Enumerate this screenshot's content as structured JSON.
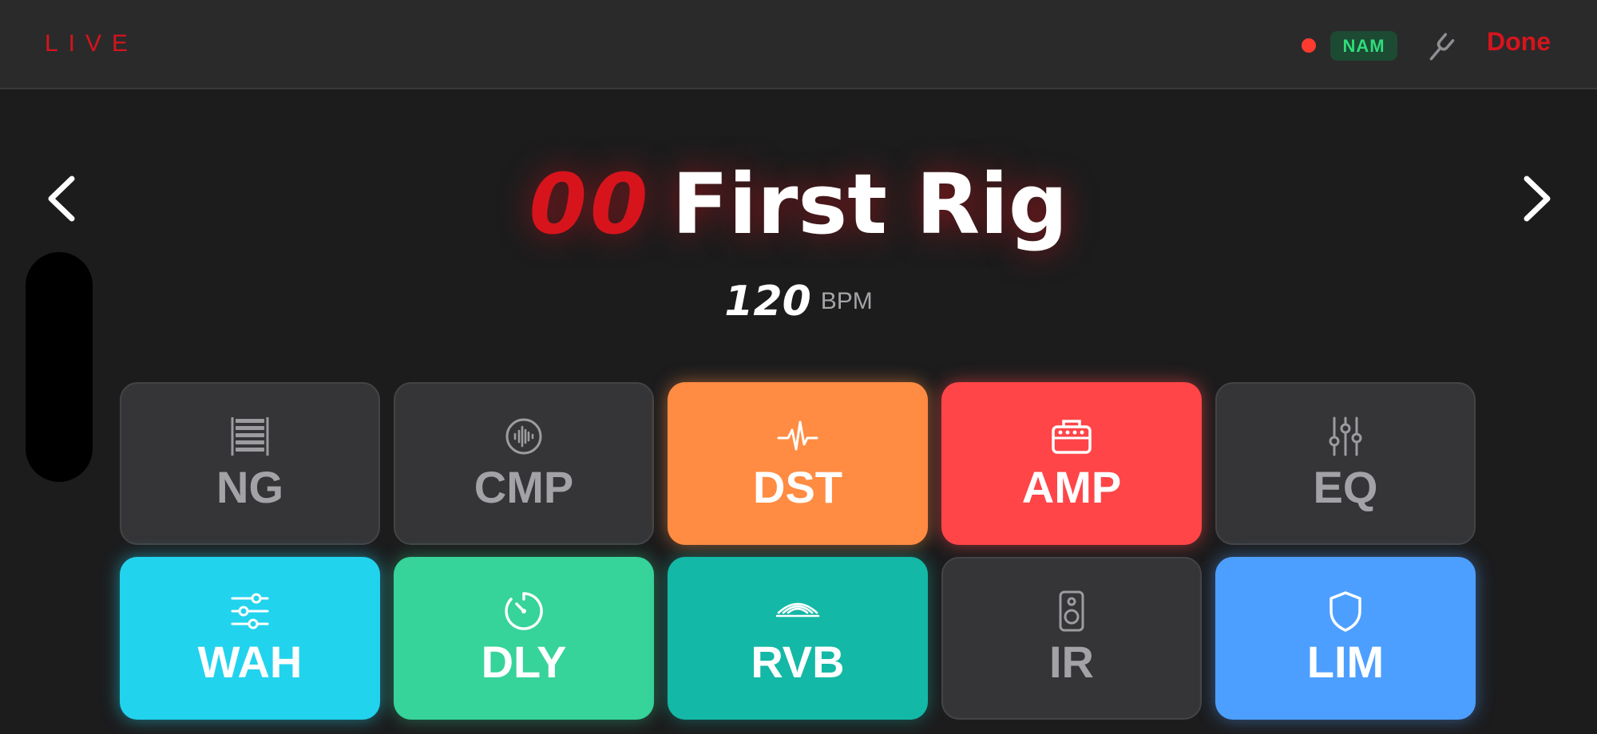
{
  "header": {
    "live_label": "LIVE",
    "nam_badge": "NAM",
    "done_label": "Done",
    "recording_color": "#ff3b30"
  },
  "rig": {
    "number": "00",
    "name": "First Rig",
    "bpm": "120",
    "bpm_unit": "BPM"
  },
  "colors": {
    "accent": "#d7141c",
    "pad_off": "#353537"
  },
  "pads": [
    {
      "label": "NG",
      "icon": "noise-gate-icon",
      "active": false,
      "color": "#353537"
    },
    {
      "label": "CMP",
      "icon": "compressor-waveform-icon",
      "active": false,
      "color": "#353537"
    },
    {
      "label": "DST",
      "icon": "waveform-pulse-icon",
      "active": true,
      "color": "#ff8c42"
    },
    {
      "label": "AMP",
      "icon": "amp-head-icon",
      "active": true,
      "color": "#ff4548"
    },
    {
      "label": "EQ",
      "icon": "eq-sliders-icon",
      "active": false,
      "color": "#353537"
    },
    {
      "label": "WAH",
      "icon": "wah-sliders-icon",
      "active": true,
      "color": "#22d3ee"
    },
    {
      "label": "DLY",
      "icon": "timer-icon",
      "active": true,
      "color": "#36d39a"
    },
    {
      "label": "RVB",
      "icon": "reverb-waves-icon",
      "active": true,
      "color": "#14b8a6"
    },
    {
      "label": "IR",
      "icon": "speaker-icon",
      "active": false,
      "color": "#353537"
    },
    {
      "label": "LIM",
      "icon": "shield-icon",
      "active": true,
      "color": "#4d9fff"
    }
  ]
}
